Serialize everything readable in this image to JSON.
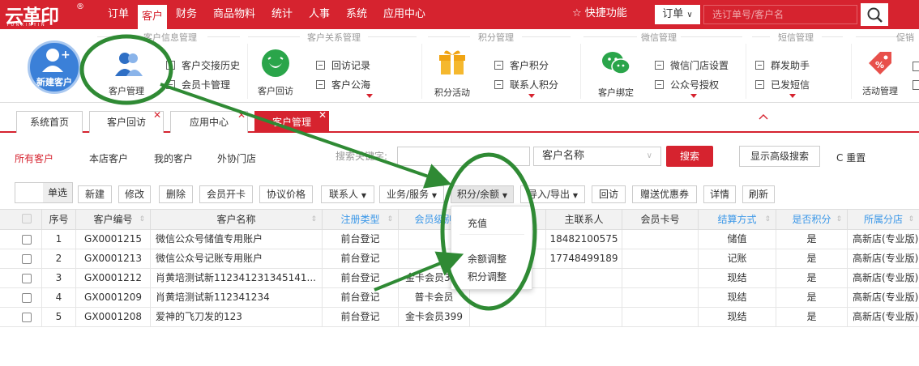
{
  "logo": {
    "text": "云革印",
    "sub": "YUNXINYIN",
    "reg": "®"
  },
  "nav": [
    {
      "label": "订单",
      "active": false
    },
    {
      "label": "客户",
      "active": true
    },
    {
      "label": "财务",
      "active": false
    },
    {
      "label": "商品物料",
      "active": false
    },
    {
      "label": "统计",
      "active": false
    },
    {
      "label": "人事",
      "active": false
    },
    {
      "label": "系统",
      "active": false
    },
    {
      "label": "应用中心",
      "active": false
    }
  ],
  "header": {
    "quick_label": "快捷功能",
    "order_select": "订单",
    "search_placeholder": "选订单号/客户名"
  },
  "ribbon": {
    "groups": [
      "客户信息管理",
      "客户关系管理",
      "积分管理",
      "微信管理",
      "短信管理",
      "促销"
    ],
    "new_customer": "新建客户",
    "customer_manage": "客户管理",
    "interaction_history": "客户交接历史",
    "member_card_manage": "会员卡管理",
    "customer_visit": "客户回访",
    "visit_record": "回访记录",
    "customer_pool": "客户公海",
    "points_activity": "积分活动",
    "customer_points": "客户积分",
    "contact_points": "联系人积分",
    "customer_bind": "客户绑定",
    "wechat_store_settings": "微信门店设置",
    "official_account_auth": "公众号授权",
    "group_assistant": "群发助手",
    "sent_sms": "已发短信",
    "activity_manage": "活动管理"
  },
  "tabs": [
    {
      "label": "系统首页",
      "closable": false,
      "active": false
    },
    {
      "label": "客户回访",
      "closable": true,
      "active": false
    },
    {
      "label": "应用中心",
      "closable": true,
      "active": false
    },
    {
      "label": "客户管理",
      "closable": true,
      "active": true
    }
  ],
  "filters": {
    "scope": [
      "所有客户",
      "本店客户",
      "我的客户",
      "外协门店"
    ],
    "keyword_label": "搜索关键字:",
    "keyword_value": "",
    "field_select": "客户名称",
    "search_button": "搜索",
    "advanced_button": "显示高级搜索",
    "reset_button": "重置"
  },
  "toolbar": {
    "select_mode": "单选",
    "buttons": [
      "新建",
      "修改",
      "删除",
      "会员开卡",
      "协议价格",
      "联系人",
      "业务/服务",
      "积分/余额",
      "导入/导出",
      "回访",
      "赠送优惠券",
      "详情",
      "刷新"
    ]
  },
  "dropdown": {
    "items": [
      "充值",
      "余额调整",
      "积分调整"
    ]
  },
  "table": {
    "columns": [
      "序号",
      "客户编号",
      "客户名称",
      "注册类型",
      "会员级别",
      "",
      "主联系人",
      "会员卡号",
      "结算方式",
      "是否积分",
      "所属分店"
    ],
    "rows": [
      {
        "no": "1",
        "code": "GX0001215",
        "name": "微信公众号储值专用账户",
        "reg": "前台登记",
        "level": "",
        "c6": "",
        "contact": "18482100575",
        "card": "",
        "settle": "储值",
        "points": "是",
        "store": "高新店(专业版)"
      },
      {
        "no": "2",
        "code": "GX0001213",
        "name": "微信公众号记账专用账户",
        "reg": "前台登记",
        "level": "",
        "c6": "",
        "contact": "17748499189",
        "card": "",
        "settle": "记账",
        "points": "是",
        "store": "高新店(专业版)"
      },
      {
        "no": "3",
        "code": "GX0001212",
        "name": "肖黄培测试新112341231345141...",
        "reg": "前台登记",
        "level": "金卡会员399",
        "c6": "",
        "contact": "",
        "card": "",
        "settle": "现结",
        "points": "是",
        "store": "高新店(专业版)"
      },
      {
        "no": "4",
        "code": "GX0001209",
        "name": "肖黄培测试新112341234",
        "reg": "前台登记",
        "level": "普卡会员",
        "c6": "",
        "contact": "",
        "card": "",
        "settle": "现结",
        "points": "是",
        "store": "高新店(专业版)"
      },
      {
        "no": "5",
        "code": "GX0001208",
        "name": "爱神的飞刀发的123",
        "reg": "前台登记",
        "level": "金卡会员399",
        "c6": "",
        "contact": "",
        "card": "",
        "settle": "现结",
        "points": "是",
        "store": "高新店(专业版)"
      }
    ]
  },
  "colors": {
    "brand_red": "#d6232f",
    "annotation_green": "#2f8a34",
    "link_blue": "#3a97e8"
  }
}
